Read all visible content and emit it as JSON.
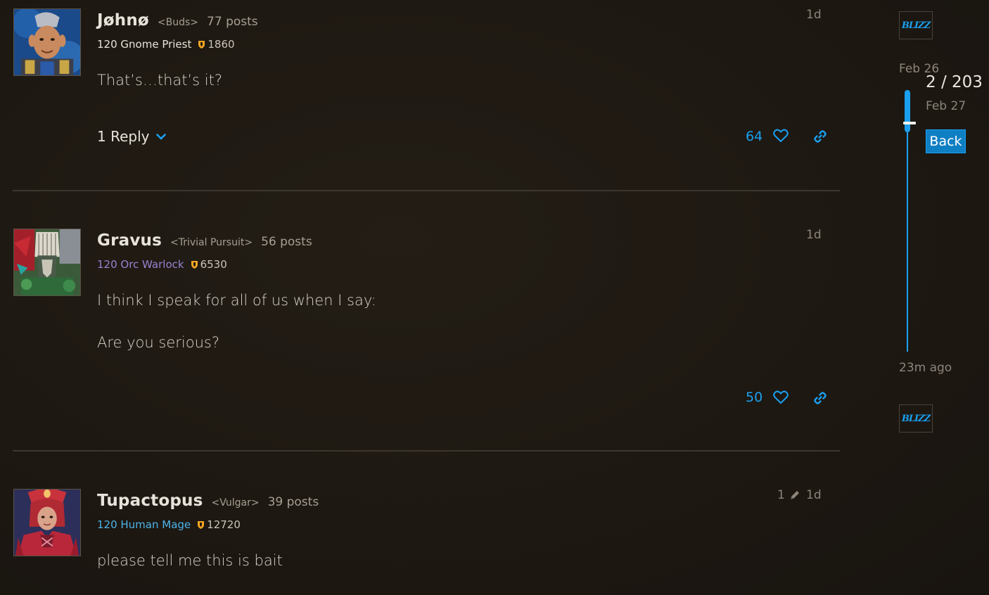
{
  "posts": [
    {
      "username": "Jøhnø",
      "guild": "<Buds>",
      "posts": "77 posts",
      "character": "120 Gnome Priest",
      "achievement": "1860",
      "date": "1d",
      "body": [
        "That’s…that’s it?"
      ],
      "replies": "1 Reply",
      "likes": "64"
    },
    {
      "username": "Gravus",
      "guild": "<Trivial Pursuit>",
      "posts": "56 posts",
      "character": "120 Orc Warlock",
      "achievement": "6530",
      "date": "1d",
      "body": [
        "I think I speak for all of us when I say:",
        "Are you serious?"
      ],
      "likes": "50"
    },
    {
      "username": "Tupactopus",
      "guild": "<Vulgar>",
      "posts": "39 posts",
      "character": "120 Human Mage",
      "achievement": "12720",
      "date": "1d",
      "edits": "1",
      "body": [
        "please tell me this is bait"
      ]
    }
  ],
  "timeline": {
    "start_date": "Feb 26",
    "position": "2 / 203",
    "position_date": "Feb 27",
    "back_label": "Back",
    "end_date": "23m ago",
    "progress": 0.0099,
    "logo_text": "BLIZZ"
  },
  "colors": {
    "accent": "#1aa0f0",
    "priest": "#e8e3da",
    "warlock": "#9a82d1",
    "mage": "#4db4ea",
    "achievement_shield": "#f5a623"
  },
  "icons": [
    "heart-icon",
    "link-icon",
    "chevron-down-icon",
    "pencil-icon",
    "shield-icon",
    "blizzard-logo"
  ]
}
